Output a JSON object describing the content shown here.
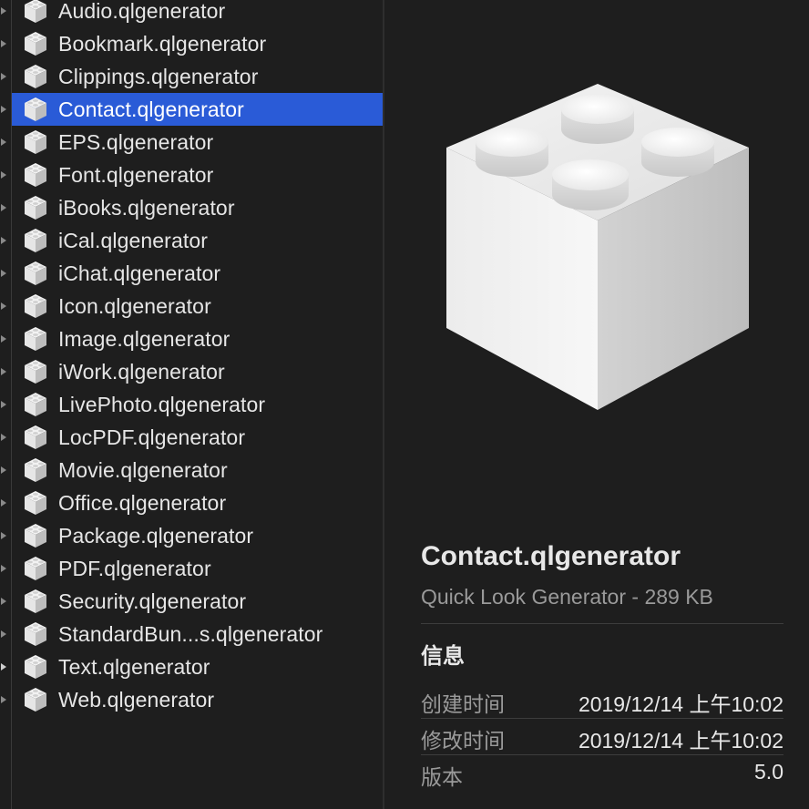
{
  "files": [
    {
      "name": "Audio.qlgenerator",
      "selected": false
    },
    {
      "name": "Bookmark.qlgenerator",
      "selected": false
    },
    {
      "name": "Clippings.qlgenerator",
      "selected": false
    },
    {
      "name": "Contact.qlgenerator",
      "selected": true
    },
    {
      "name": "EPS.qlgenerator",
      "selected": false
    },
    {
      "name": "Font.qlgenerator",
      "selected": false
    },
    {
      "name": "iBooks.qlgenerator",
      "selected": false
    },
    {
      "name": "iCal.qlgenerator",
      "selected": false
    },
    {
      "name": "iChat.qlgenerator",
      "selected": false
    },
    {
      "name": "Icon.qlgenerator",
      "selected": false
    },
    {
      "name": "Image.qlgenerator",
      "selected": false
    },
    {
      "name": "iWork.qlgenerator",
      "selected": false
    },
    {
      "name": "LivePhoto.qlgenerator",
      "selected": false
    },
    {
      "name": "LocPDF.qlgenerator",
      "selected": false
    },
    {
      "name": "Movie.qlgenerator",
      "selected": false
    },
    {
      "name": "Office.qlgenerator",
      "selected": false
    },
    {
      "name": "Package.qlgenerator",
      "selected": false
    },
    {
      "name": "PDF.qlgenerator",
      "selected": false
    },
    {
      "name": "Security.qlgenerator",
      "selected": false
    },
    {
      "name": "StandardBun...s.qlgenerator",
      "selected": false
    },
    {
      "name": "Text.qlgenerator",
      "selected": false
    },
    {
      "name": "Web.qlgenerator",
      "selected": false
    }
  ],
  "preview": {
    "icon": "plugin-bundle-icon",
    "title": "Contact.qlgenerator",
    "subtitle": "Quick Look Generator - 289 KB",
    "section_title": "信息",
    "info": [
      {
        "label": "创建时间",
        "value": "2019/12/14 上午10:02"
      },
      {
        "label": "修改时间",
        "value": "2019/12/14 上午10:02"
      },
      {
        "label": "版本",
        "value": "5.0"
      }
    ]
  },
  "colors": {
    "background": "#1e1e1e",
    "selection": "#2a5bd7",
    "text": "#e6e6e6",
    "secondary_text": "#9a9a9a"
  }
}
